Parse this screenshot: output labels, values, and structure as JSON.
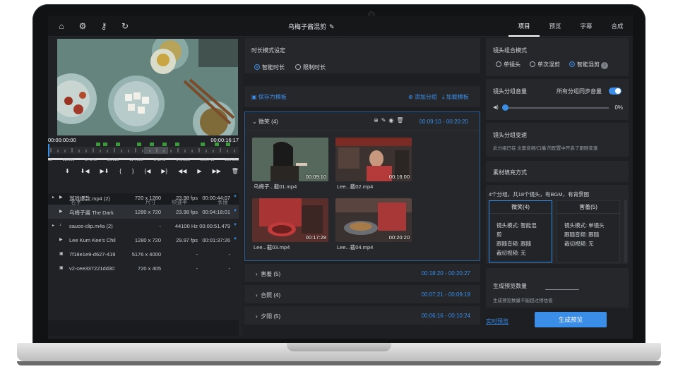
{
  "topbar": {
    "title": "乌梅子酱混剪",
    "tabs": [
      "项目",
      "预览",
      "字幕",
      "合成"
    ]
  },
  "player": {
    "tc_current": "00:00:00:00",
    "tc_total": "00:00:16:17",
    "ticks": [
      "0s",
      "28.69s",
      "57.34s",
      "86.03s",
      "114.69s",
      "143.75",
      "172.02s",
      "200.71s",
      "229.36s"
    ]
  },
  "files": {
    "headers": {
      "name": "名字",
      "size": "尺寸",
      "fps": "帧速率",
      "dur": "长度"
    },
    "rows": [
      {
        "name": "游戏爆款.mp4 (2)",
        "size": "720 x 1280",
        "fps": "23.98 fps",
        "dur": "00:00:44:07"
      },
      {
        "name": "乌梅子酱 The Dark",
        "size": "1280 x 720",
        "fps": "23.98 fps",
        "dur": "00:04:18:01"
      },
      {
        "name": "sauce-clip.m4a (2)",
        "size": "-",
        "fps": "44100 Hz",
        "dur": "00:00:51.479"
      },
      {
        "name": "Lee Kum Kee's Chil",
        "size": "1280 x 720",
        "fps": "29.97 fps",
        "dur": "00:01:37:26"
      },
      {
        "name": "7f18e1e9-d627-419",
        "size": "5176 x 4000",
        "fps": "-",
        "dur": "-"
      },
      {
        "name": "v2-cee337221dd30",
        "size": "720 x 405",
        "fps": "-",
        "dur": "-"
      }
    ]
  },
  "middle": {
    "duration_title": "时长模式设定",
    "duration_opts": [
      "智能时长",
      "限制时长"
    ],
    "save_template": "保存为模板",
    "add_group": "添加分组",
    "load_template": "加载模板",
    "open_group": {
      "name": "微笑 (4)",
      "time": "00:09:10 - 00:20:20"
    },
    "clips": [
      {
        "dur": "00:09:10",
        "name": "乌梅子...截01.mp4"
      },
      {
        "dur": "00:16:00",
        "name": "Lee...截02.mp4"
      },
      {
        "dur": "00:17:28",
        "name": "Lee...截03.mp4"
      },
      {
        "dur": "00:20:20",
        "name": "Lee...截04.mp4"
      }
    ],
    "groups": [
      {
        "name": "害羞 (5)",
        "time": "00:18:20 - 00:20:27"
      },
      {
        "name": "合照 (4)",
        "time": "00:07:21 - 00:09:19"
      },
      {
        "name": "夕阳 (5)",
        "time": "00:06:16 - 00:10:24"
      }
    ]
  },
  "right": {
    "combo_title": "镜头组合模式",
    "combo_opts": [
      "单镜头",
      "单次混剪",
      "智能混剪"
    ],
    "volume_title": "镜头分组音量",
    "volume_sync": "所有分组同步音量",
    "volume_pct": "0%",
    "speed_title": "镜头分组变速",
    "speed_desc": "此分组已在 文案音频/口播 的配置中开启了跟随变速",
    "fill_title": "素材填充方式",
    "summary": "4个分组，共18个镜头，有BGM，有背景图",
    "cards": [
      {
        "title": "微笑(4)",
        "l1": "镜头模式: 智能混",
        "l2": "剪",
        "l3": "跟随音频: 跟随",
        "l4": "裁切视频: 无"
      },
      {
        "title": "害羞(5)",
        "l1": "镜头模式: 单镜头",
        "l2": "跟随音频: 跟随",
        "l3": "裁切视频: 无",
        "l4": ""
      }
    ],
    "gen_title": "生成预览数量",
    "gen_hint": "生成预览数量不能超过预估值",
    "realtime": "实时预览",
    "gen_button": "生成预览"
  }
}
